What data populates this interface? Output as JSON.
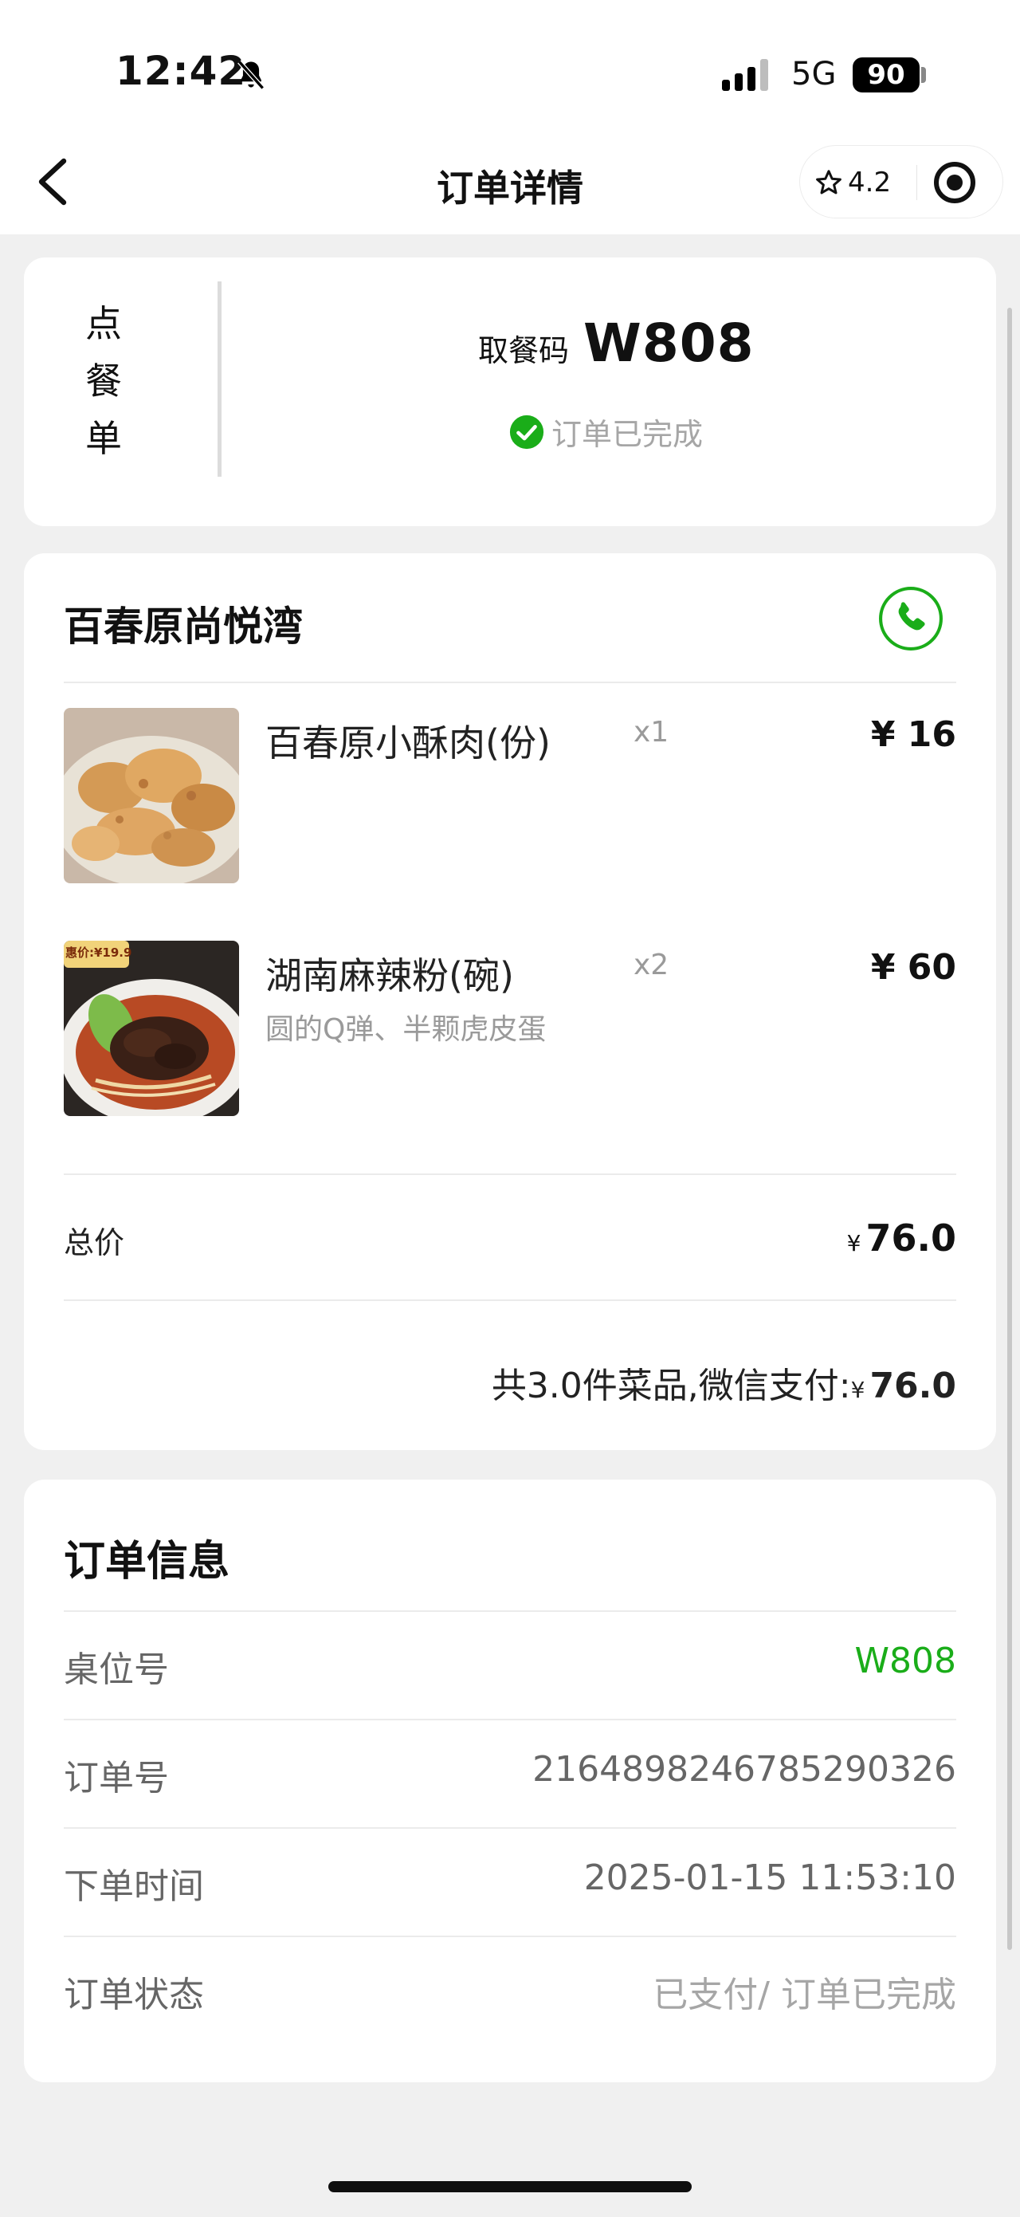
{
  "status_bar": {
    "time": "12:42",
    "network": "5G",
    "battery": "90"
  },
  "nav": {
    "title": "订单详情",
    "rating": "4.2"
  },
  "order_header": {
    "vertical_label": [
      "点",
      "餐",
      "单"
    ],
    "pickup_label": "取餐码",
    "pickup_code": "W808",
    "status": "订单已完成"
  },
  "store": {
    "name": "百春原尚悦湾",
    "items": [
      {
        "name": "百春原小酥肉(份)",
        "qty": "x1",
        "price": "¥ 16",
        "desc": "",
        "image_icon": "crispy-pork-photo"
      },
      {
        "name": "湖南麻辣粉(碗)",
        "qty": "x2",
        "price": "¥ 60",
        "desc": "圆的Q弹、半颗虎皮蛋",
        "image_icon": "spicy-noodle-photo",
        "image_badge": "惠价:¥19.9"
      }
    ],
    "total_label": "总价",
    "total_currency": "¥",
    "total_value": "76.0",
    "summary_prefix": "共3.0件菜品,微信支付:",
    "summary_currency": "¥",
    "summary_value": "76.0"
  },
  "order_info": {
    "title": "订单信息",
    "rows": [
      {
        "label": "桌位号",
        "value": "W808"
      },
      {
        "label": "订单号",
        "value": "2164898246785290326"
      },
      {
        "label": "下单时间",
        "value": "2025-01-15 11:53:10"
      },
      {
        "label": "订单状态",
        "value": "已支付/ 订单已完成"
      }
    ]
  },
  "colors": {
    "accent_green": "#1aad19",
    "page_bg": "#f0f0f0",
    "card_bg": "#ffffff"
  }
}
